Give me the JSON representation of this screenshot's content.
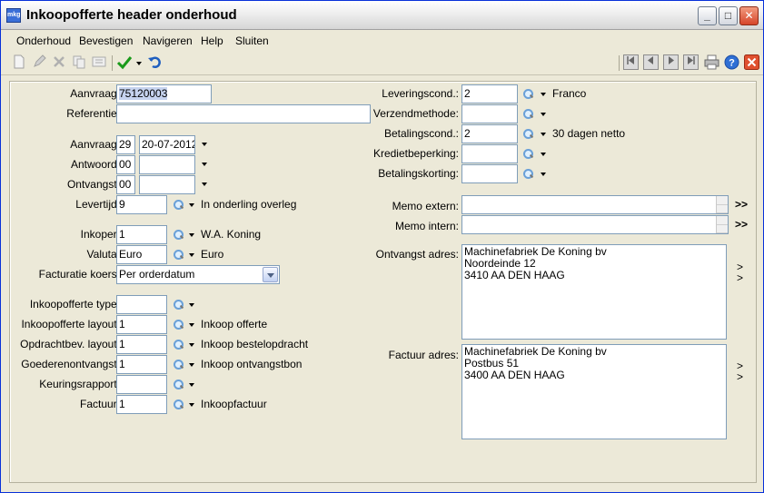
{
  "window": {
    "title": "Inkoopofferte header onderhoud",
    "app_icon_text": "mkg",
    "minimize": "_",
    "maximize": "□",
    "close": "✕"
  },
  "menu": [
    "Onderhoud",
    "Bevestigen",
    "Navigeren",
    "Help",
    "Sluiten"
  ],
  "toolbar": {
    "icons": [
      "new-icon",
      "edit-icon",
      "delete-icon",
      "copy-icon",
      "numbering-icon",
      "confirm-icon",
      "undo-icon"
    ],
    "nav_icons": [
      "first-icon",
      "previous-icon",
      "next-icon",
      "last-icon",
      "print-icon",
      "help-icon",
      "close-icon"
    ]
  },
  "left": {
    "aanvraag_label": "Aanvraag:",
    "aanvraag_value": "75120003",
    "referentie_label": "Referentie:",
    "referentie_value": "",
    "aanvraag2_label": "Aanvraag:",
    "aanvraag2_week": "29",
    "aanvraag2_date": "20-07-2012",
    "antwoord_label": "Antwoord:",
    "antwoord_week": "00",
    "antwoord_date": "",
    "ontvangst_label": "Ontvangst:",
    "ontvangst_week": "00",
    "ontvangst_date": "",
    "levertijd_label": "Levertijd:",
    "levertijd_value": "9",
    "levertijd_desc": "In onderling overleg",
    "inkoper_label": "Inkoper:",
    "inkoper_value": "1",
    "inkoper_desc": "W.A. Koning",
    "valuta_label": "Valuta:",
    "valuta_value": "Euro",
    "valuta_desc": "Euro",
    "facturatie_label": "Facturatie koers:",
    "facturatie_value": "Per orderdatum",
    "type_label": "Inkoopofferte type:",
    "type_value": "",
    "layout_label": "Inkoopofferte layout:",
    "layout_value": "1",
    "layout_desc": "Inkoop offerte",
    "opdracht_label": "Opdrachtbev. layout:",
    "opdracht_value": "1",
    "opdracht_desc": "Inkoop bestelopdracht",
    "goederen_label": "Goederenontvangst:",
    "goederen_value": "1",
    "goederen_desc": "Inkoop ontvangstbon",
    "keuring_label": "Keuringsrapport:",
    "keuring_value": "",
    "factuur_label": "Factuur:",
    "factuur_value": "1",
    "factuur_desc": "Inkoopfactuur"
  },
  "right": {
    "levering_label": "Leveringscond.:",
    "levering_value": "2",
    "levering_desc": "Franco",
    "verzend_label": "Verzendmethode:",
    "verzend_value": "",
    "betaling_label": "Betalingscond.:",
    "betaling_value": "2",
    "betaling_desc": "30 dagen netto",
    "krediet_label": "Kredietbeperking:",
    "krediet_value": "",
    "korting_label": "Betalingskorting:",
    "korting_value": "",
    "memo_extern_label": "Memo extern:",
    "memo_extern_value": "",
    "memo_intern_label": "Memo intern:",
    "memo_intern_value": "",
    "more_symbol": ">>",
    "ontvangst_label": "Ontvangst adres:",
    "ontvangst_address": "Machinefabriek De Koning bv\nNoordeinde 12\n3410 AA DEN HAAG",
    "factuur_label": "Factuur adres:",
    "factuur_address": "Machinefabriek De Koning bv\nPostbus 51\n3400 AA DEN HAAG",
    "chevron": ">"
  }
}
